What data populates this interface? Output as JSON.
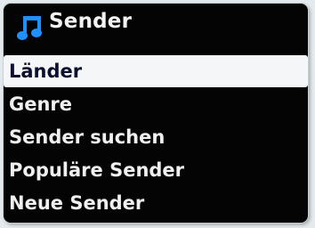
{
  "header": {
    "title": "Sender",
    "icon": "music-note-icon",
    "icon_color": "#1e90ff"
  },
  "menu": {
    "items": [
      {
        "label": "Länder",
        "selected": true
      },
      {
        "label": "Genre",
        "selected": false
      },
      {
        "label": "Sender suchen",
        "selected": false
      },
      {
        "label": "Populäre Sender",
        "selected": false
      },
      {
        "label": "Neue Sender",
        "selected": false
      }
    ]
  }
}
